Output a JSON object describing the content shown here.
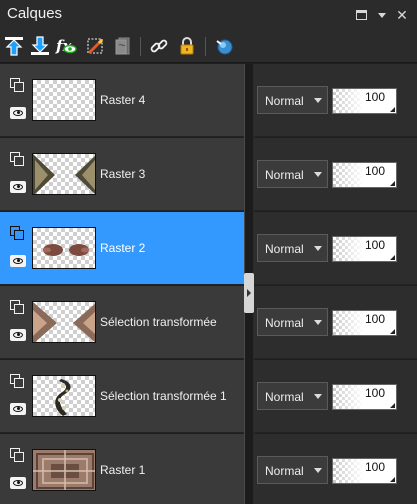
{
  "panel": {
    "title": "Calques",
    "title_icons": [
      "restore-icon",
      "dropdown-icon",
      "close-icon"
    ],
    "close_glyph": "✕"
  },
  "toolbar": {
    "tools": [
      "move-layer-up-icon",
      "move-layer-down-icon",
      "toggle-visibility-icon",
      "edit-mask-icon",
      "lock-mask-icon",
      "link-layers-icon",
      "lock-icon",
      "merge-icon"
    ]
  },
  "layers": [
    {
      "name": "Raster 4",
      "blend_mode": "Normal",
      "opacity": "100",
      "selected": false
    },
    {
      "name": "Raster 3",
      "blend_mode": "Normal",
      "opacity": "100",
      "selected": false
    },
    {
      "name": "Raster 2",
      "blend_mode": "Normal",
      "opacity": "100",
      "selected": true
    },
    {
      "name": "Sélection transformée",
      "blend_mode": "Normal",
      "opacity": "100",
      "selected": false
    },
    {
      "name": "Sélection transformée 1",
      "blend_mode": "Normal",
      "opacity": "100",
      "selected": false
    },
    {
      "name": "Raster 1",
      "blend_mode": "Normal",
      "opacity": "100",
      "selected": false
    }
  ],
  "colors": {
    "selection": "#3399ff",
    "row_background": "#3a3a3a",
    "panel_background": "#2b2b2b"
  }
}
